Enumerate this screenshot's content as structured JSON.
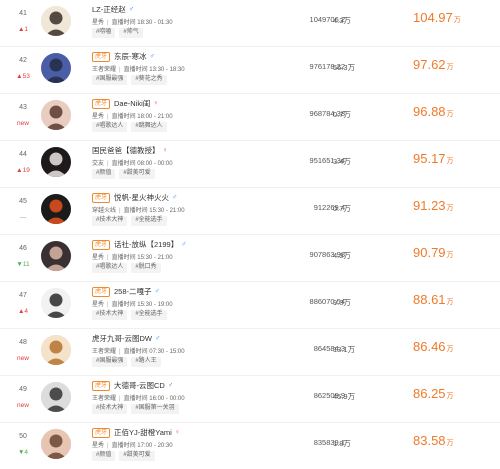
{
  "rows": [
    {
      "rank": "41",
      "change": "▲1",
      "change_kind": "up",
      "platform": "",
      "name": "LZ-正经赵",
      "gender": "♂",
      "gender_kind": "male",
      "game": "星秀",
      "live_time": "直播时间 18:30 - 01:30",
      "tags": [
        "#唠嗑",
        "#帅气"
      ],
      "score": "1049706.2",
      "popularity": "4.3万",
      "heat": "104.97",
      "heat_unit": "万",
      "avatar": {
        "bg": "#f1e7d7",
        "fg": "#3a2d27"
      }
    },
    {
      "rank": "42",
      "change": "▲53",
      "change_kind": "up",
      "platform": "虎牙",
      "name": "东辰-寒冰",
      "gender": "♂",
      "gender_kind": "male",
      "game": "王者荣耀",
      "live_time": "直播时间 13:30 - 18:30",
      "tags": [
        "#国服最强",
        "#葵花之秀"
      ],
      "score": "976178.22",
      "popularity": "56.3万",
      "heat": "97.62",
      "heat_unit": "万",
      "avatar": {
        "bg": "#4a5ea8",
        "fg": "#222a44"
      }
    },
    {
      "rank": "43",
      "change": "new",
      "change_kind": "new",
      "platform": "虎牙",
      "name": "Dae-Niki闺",
      "gender": "♀",
      "gender_kind": "female",
      "game": "星秀",
      "live_time": "直播时间 18:00 - 21:00",
      "tags": [
        "#唱歌达人",
        "#跳舞达人"
      ],
      "score": "968784.38",
      "popularity": "0.7万",
      "heat": "96.88",
      "heat_unit": "万",
      "avatar": {
        "bg": "#e9cdbf",
        "fg": "#5b3a30"
      }
    },
    {
      "rank": "44",
      "change": "▲19",
      "change_kind": "up",
      "platform": "",
      "name": "国民爸爸【德教授】",
      "gender": "♀",
      "gender_kind": "female",
      "game": "交友",
      "live_time": "直播时间 08:00 - 00:00",
      "tags": [
        "#颜值",
        "#甜美可爱"
      ],
      "score": "951651.34",
      "popularity": "3.4万",
      "heat": "95.17",
      "heat_unit": "万",
      "avatar": {
        "bg": "#1e1a1c",
        "fg": "#ece7e3"
      }
    },
    {
      "rank": "45",
      "change": "—",
      "change_kind": "flat",
      "platform": "虎牙",
      "name": "悦帆-星火神火火",
      "gender": "♂",
      "gender_kind": "male",
      "game": "穿越火线",
      "live_time": "直播时间 15:30 - 21:00",
      "tags": [
        "#技术大神",
        "#全能选手"
      ],
      "score": "912269.4",
      "popularity": "0.7万",
      "heat": "91.23",
      "heat_unit": "万",
      "avatar": {
        "bg": "#1b1b1b",
        "fg": "#e8501e"
      }
    },
    {
      "rank": "46",
      "change": "▼11",
      "change_kind": "down",
      "platform": "虎牙",
      "name": "话社-放纵【2199】",
      "gender": "♂",
      "gender_kind": "male",
      "game": "星秀",
      "live_time": "直播时间 15:30 - 21:00",
      "tags": [
        "#唱歌达人",
        "#脱口秀"
      ],
      "score": "907863.98",
      "popularity": "4.5万",
      "heat": "90.79",
      "heat_unit": "万",
      "avatar": {
        "bg": "#3a3033",
        "fg": "#dcb8a6"
      }
    },
    {
      "rank": "47",
      "change": "▲4",
      "change_kind": "up",
      "platform": "虎牙",
      "name": "258-二嘎子",
      "gender": "♂",
      "gender_kind": "male",
      "game": "星秀",
      "live_time": "直播时间 15:30 - 19:00",
      "tags": [
        "#技术大神",
        "#全能选手"
      ],
      "score": "886070.54",
      "popularity": "9.0万",
      "heat": "88.61",
      "heat_unit": "万",
      "avatar": {
        "bg": "#f2f2f2",
        "fg": "#2a2a2a"
      }
    },
    {
      "rank": "48",
      "change": "new",
      "change_kind": "new",
      "platform": "",
      "name": "虎牙九哥-云图DW",
      "gender": "♂",
      "gender_kind": "male",
      "game": "王者荣耀",
      "live_time": "直播时间 07:30 - 15:00",
      "tags": [
        "#国服最强",
        "#路人王"
      ],
      "score": "864584.3",
      "popularity": "13.1万",
      "heat": "86.46",
      "heat_unit": "万",
      "avatar": {
        "bg": "#f4e3c8",
        "fg": "#b5722f"
      }
    },
    {
      "rank": "49",
      "change": "new",
      "change_kind": "new",
      "platform": "虎牙",
      "name": "大德哥-云图CD",
      "gender": "♂",
      "gender_kind": "male",
      "game": "王者荣耀",
      "live_time": "直播时间 16:00 - 00:00",
      "tags": [
        "#技术大神",
        "#国服第一关羽"
      ],
      "score": "862509.9",
      "popularity": "45.9万",
      "heat": "86.25",
      "heat_unit": "万",
      "avatar": {
        "bg": "#dcdcdc",
        "fg": "#333333"
      }
    },
    {
      "rank": "50",
      "change": "▼4",
      "change_kind": "down",
      "platform": "虎牙",
      "name": "正佰YJ-甜橙Yami",
      "gender": "♀",
      "gender_kind": "female",
      "game": "星秀",
      "live_time": "直播时间 17:00 - 20:30",
      "tags": [
        "#颜值",
        "#甜美可爱"
      ],
      "score": "835839.1",
      "popularity": "1.8万",
      "heat": "83.58",
      "heat_unit": "万",
      "avatar": {
        "bg": "#e6c6b2",
        "fg": "#6a4334"
      }
    }
  ]
}
